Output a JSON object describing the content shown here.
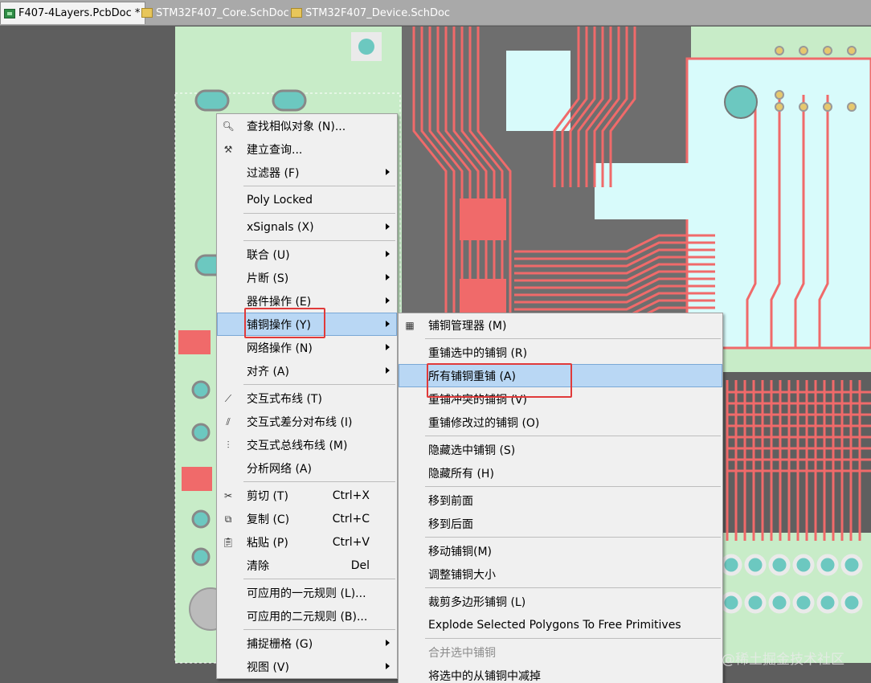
{
  "tabs": [
    {
      "label": "F407-4Layers.PcbDoc *",
      "icon": "pcb-document-icon",
      "active": true
    },
    {
      "label": "STM32F407_Core.SchDoc",
      "icon": "schematic-document-icon",
      "active": false
    },
    {
      "label": "STM32F407_Device.SchDoc",
      "icon": "schematic-document-icon",
      "active": false
    }
  ],
  "colors": {
    "board": "#c8ecc8",
    "copper": "#f06a6a",
    "copper_area": "#d8fbfb",
    "pad": "#6cc8c0",
    "menu_bg": "#f0f0f0",
    "highlight": "#b9d7f4",
    "annotation": "#e03a3a"
  },
  "context_menu": {
    "items": [
      {
        "label": "查找相似对象 (N)...",
        "icon": "magnifier-icon"
      },
      {
        "label": "建立查询...",
        "icon": "hammer-icon"
      },
      {
        "label": "过滤器 (F)",
        "submenu": true
      },
      {
        "sep": true
      },
      {
        "label": "Poly Locked"
      },
      {
        "sep": true
      },
      {
        "label": "xSignals (X)",
        "submenu": true
      },
      {
        "sep": true
      },
      {
        "label": "联合 (U)",
        "submenu": true
      },
      {
        "label": "片断 (S)",
        "submenu": true
      },
      {
        "label": "器件操作 (E)",
        "submenu": true
      },
      {
        "label": "铺铜操作 (Y)",
        "submenu": true,
        "highlight": true
      },
      {
        "label": "网络操作 (N)",
        "submenu": true
      },
      {
        "label": "对齐 (A)",
        "submenu": true
      },
      {
        "sep": true
      },
      {
        "label": "交互式布线 (T)",
        "icon": "route-icon"
      },
      {
        "label": "交互式差分对布线 (I)",
        "icon": "diff-pair-route-icon"
      },
      {
        "label": "交互式总线布线 (M)",
        "icon": "bus-route-icon"
      },
      {
        "label": "分析网络 (A)"
      },
      {
        "sep": true
      },
      {
        "label": "剪切 (T)",
        "icon": "scissors-icon",
        "shortcut": "Ctrl+X"
      },
      {
        "label": "复制 (C)",
        "icon": "copy-icon",
        "shortcut": "Ctrl+C"
      },
      {
        "label": "粘贴 (P)",
        "icon": "paste-icon",
        "shortcut": "Ctrl+V"
      },
      {
        "label": "清除",
        "shortcut": "Del"
      },
      {
        "sep": true
      },
      {
        "label": "可应用的一元规则 (L)..."
      },
      {
        "label": "可应用的二元规则 (B)..."
      },
      {
        "sep": true
      },
      {
        "label": "捕捉栅格 (G)",
        "submenu": true
      },
      {
        "label": "视图 (V)",
        "submenu": true
      }
    ]
  },
  "polygon_submenu": {
    "items": [
      {
        "label": "铺铜管理器 (M)",
        "icon": "polygon-manager-icon"
      },
      {
        "sep": true
      },
      {
        "label": "重铺选中的铺铜 (R)"
      },
      {
        "label": "所有铺铜重铺 (A)",
        "highlight": true
      },
      {
        "label": "重铺冲突的铺铜 (V)"
      },
      {
        "label": "重铺修改过的铺铜 (O)"
      },
      {
        "sep": true
      },
      {
        "label": "隐藏选中铺铜 (S)"
      },
      {
        "label": "隐藏所有 (H)"
      },
      {
        "sep": true
      },
      {
        "label": "移到前面"
      },
      {
        "label": "移到后面"
      },
      {
        "sep": true
      },
      {
        "label": "移动铺铜(M)"
      },
      {
        "label": "调整铺铜大小"
      },
      {
        "sep": true
      },
      {
        "label": "裁剪多边形铺铜 (L)"
      },
      {
        "label": "Explode Selected Polygons To Free Primitives"
      },
      {
        "sep": true
      },
      {
        "label": "合并选中铺铜",
        "disabled": true
      },
      {
        "label": "将选中的从铺铜中减掉"
      }
    ]
  },
  "watermark": "@稀土掘金技术社区"
}
